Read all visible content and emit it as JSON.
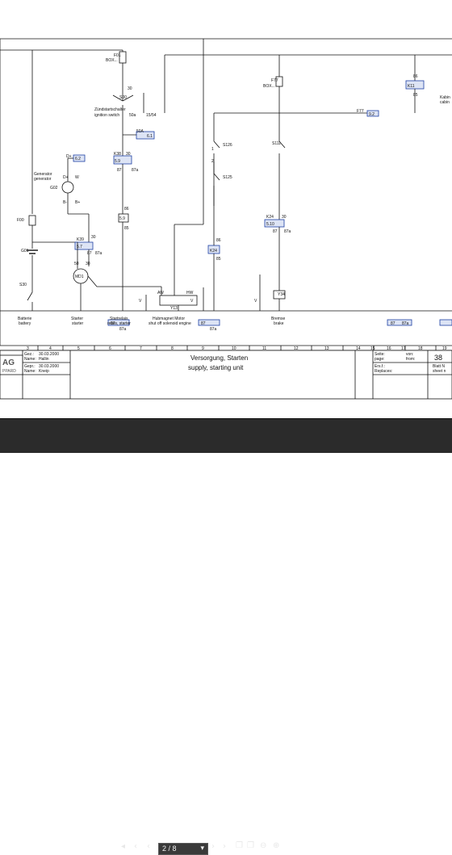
{
  "components": {
    "f01": {
      "ref": "F01",
      "loc": "BOX..."
    },
    "s00": {
      "ref": "S00",
      "label_de": "Zündstartschalter",
      "label_en": "ignition switch",
      "t50a": "50a",
      "t15_54": "15/54",
      "t30": "30"
    },
    "x50a": {
      "ref": "50A",
      "xref": "6.1"
    },
    "k38": {
      "ref": "K38",
      "xref": "5.9",
      "t30": "30",
      "t87": "87",
      "t87a": "87a",
      "t86": "86",
      "t85": "85",
      "coil_xref": "5.9"
    },
    "dplus": {
      "ref": "D+",
      "xref": "6.2"
    },
    "g02": {
      "ref": "G02",
      "label_de": "Generator",
      "label_en": "generator",
      "t_d": "D+",
      "t_w": "W",
      "t_b": "B+",
      "t_bm": "B-"
    },
    "f00": {
      "ref": "F00"
    },
    "k39": {
      "ref": "K39",
      "xref": "5.7",
      "t30": "30",
      "t87": "87",
      "t87a": "87a"
    },
    "g01": {
      "ref": "G01"
    },
    "md1": {
      "ref": "MD1",
      "t50": "50",
      "t30": "30"
    },
    "s30": {
      "ref": "S30"
    },
    "f77": {
      "ref": "F77",
      "loc": "BOX..."
    },
    "f77_xref": {
      "ref": "F77",
      "xref": "9.2"
    },
    "s126": {
      "ref": "S126"
    },
    "s125": {
      "ref": "S125"
    },
    "s111": {
      "ref": "S111"
    },
    "k24": {
      "ref": "K24",
      "xref": "5.10",
      "t30": "30",
      "t87": "87",
      "t87a": "87a",
      "coil": "K24",
      "t86": "86",
      "t85": "85"
    },
    "y13": {
      "ref": "Y13",
      "aw": "AW",
      "hw": "HW"
    },
    "y34": {
      "ref": "Y34"
    },
    "k11": {
      "ref": "K11",
      "t86": "86",
      "t85": "85"
    },
    "kabin": {
      "de": "Kabin",
      "en": "cabin"
    },
    "bottom_xrefs": [
      "87",
      "87a"
    ],
    "v_labels": [
      "V",
      "V",
      "V"
    ],
    "t1": "1",
    "t2": "2"
  },
  "labels": {
    "batterie_de": "Batterie",
    "batterie_en": "battery",
    "starter_de": "Starter",
    "starter_en": "starter",
    "startrelais_de": "Startrelais",
    "startrelais_en": "relais, starter",
    "hubmagnet_de": "Hubmagnet Motor",
    "hubmagnet_en": "shut off solenoid engine",
    "bremse_de": "Bremse",
    "bremse_en": "brake"
  },
  "grid": {
    "columns": [
      "3",
      "4",
      "5",
      "6",
      "7",
      "8",
      "9",
      "10",
      "11",
      "12",
      "13",
      "14",
      "15",
      "16",
      "17",
      "18",
      "19"
    ]
  },
  "title_block": {
    "logo_top": "AG",
    "logo_bottom": "PPARD",
    "gez_label": "Gez.:",
    "gez_date": "30.03.2000",
    "name_label": "Name:",
    "name_value": "Hallin",
    "gepr_label": "Gepr.:",
    "gepr_date": "30.03.2000",
    "name2_label": "Name:",
    "name2_value": "Kneip",
    "title_de": "Versorgung, Starten",
    "title_en": "supply, starting unit",
    "seite_label": "Seite:",
    "seite_label_en": "page:",
    "von_label": "von:",
    "from_label": "from:",
    "ers_label": "Ers.f.:",
    "replaces_label": "Replaces:",
    "doc_no": "38",
    "blatt_label": "Blatt N",
    "sheet_label": "sheet n"
  },
  "toolbar": {
    "page_value": "2 / 8"
  },
  "colors": {
    "line": "#111111",
    "xref_fill": "#dde4f5",
    "xref_border": "#1d3fa3",
    "toolbar": "#2b2b2b"
  }
}
